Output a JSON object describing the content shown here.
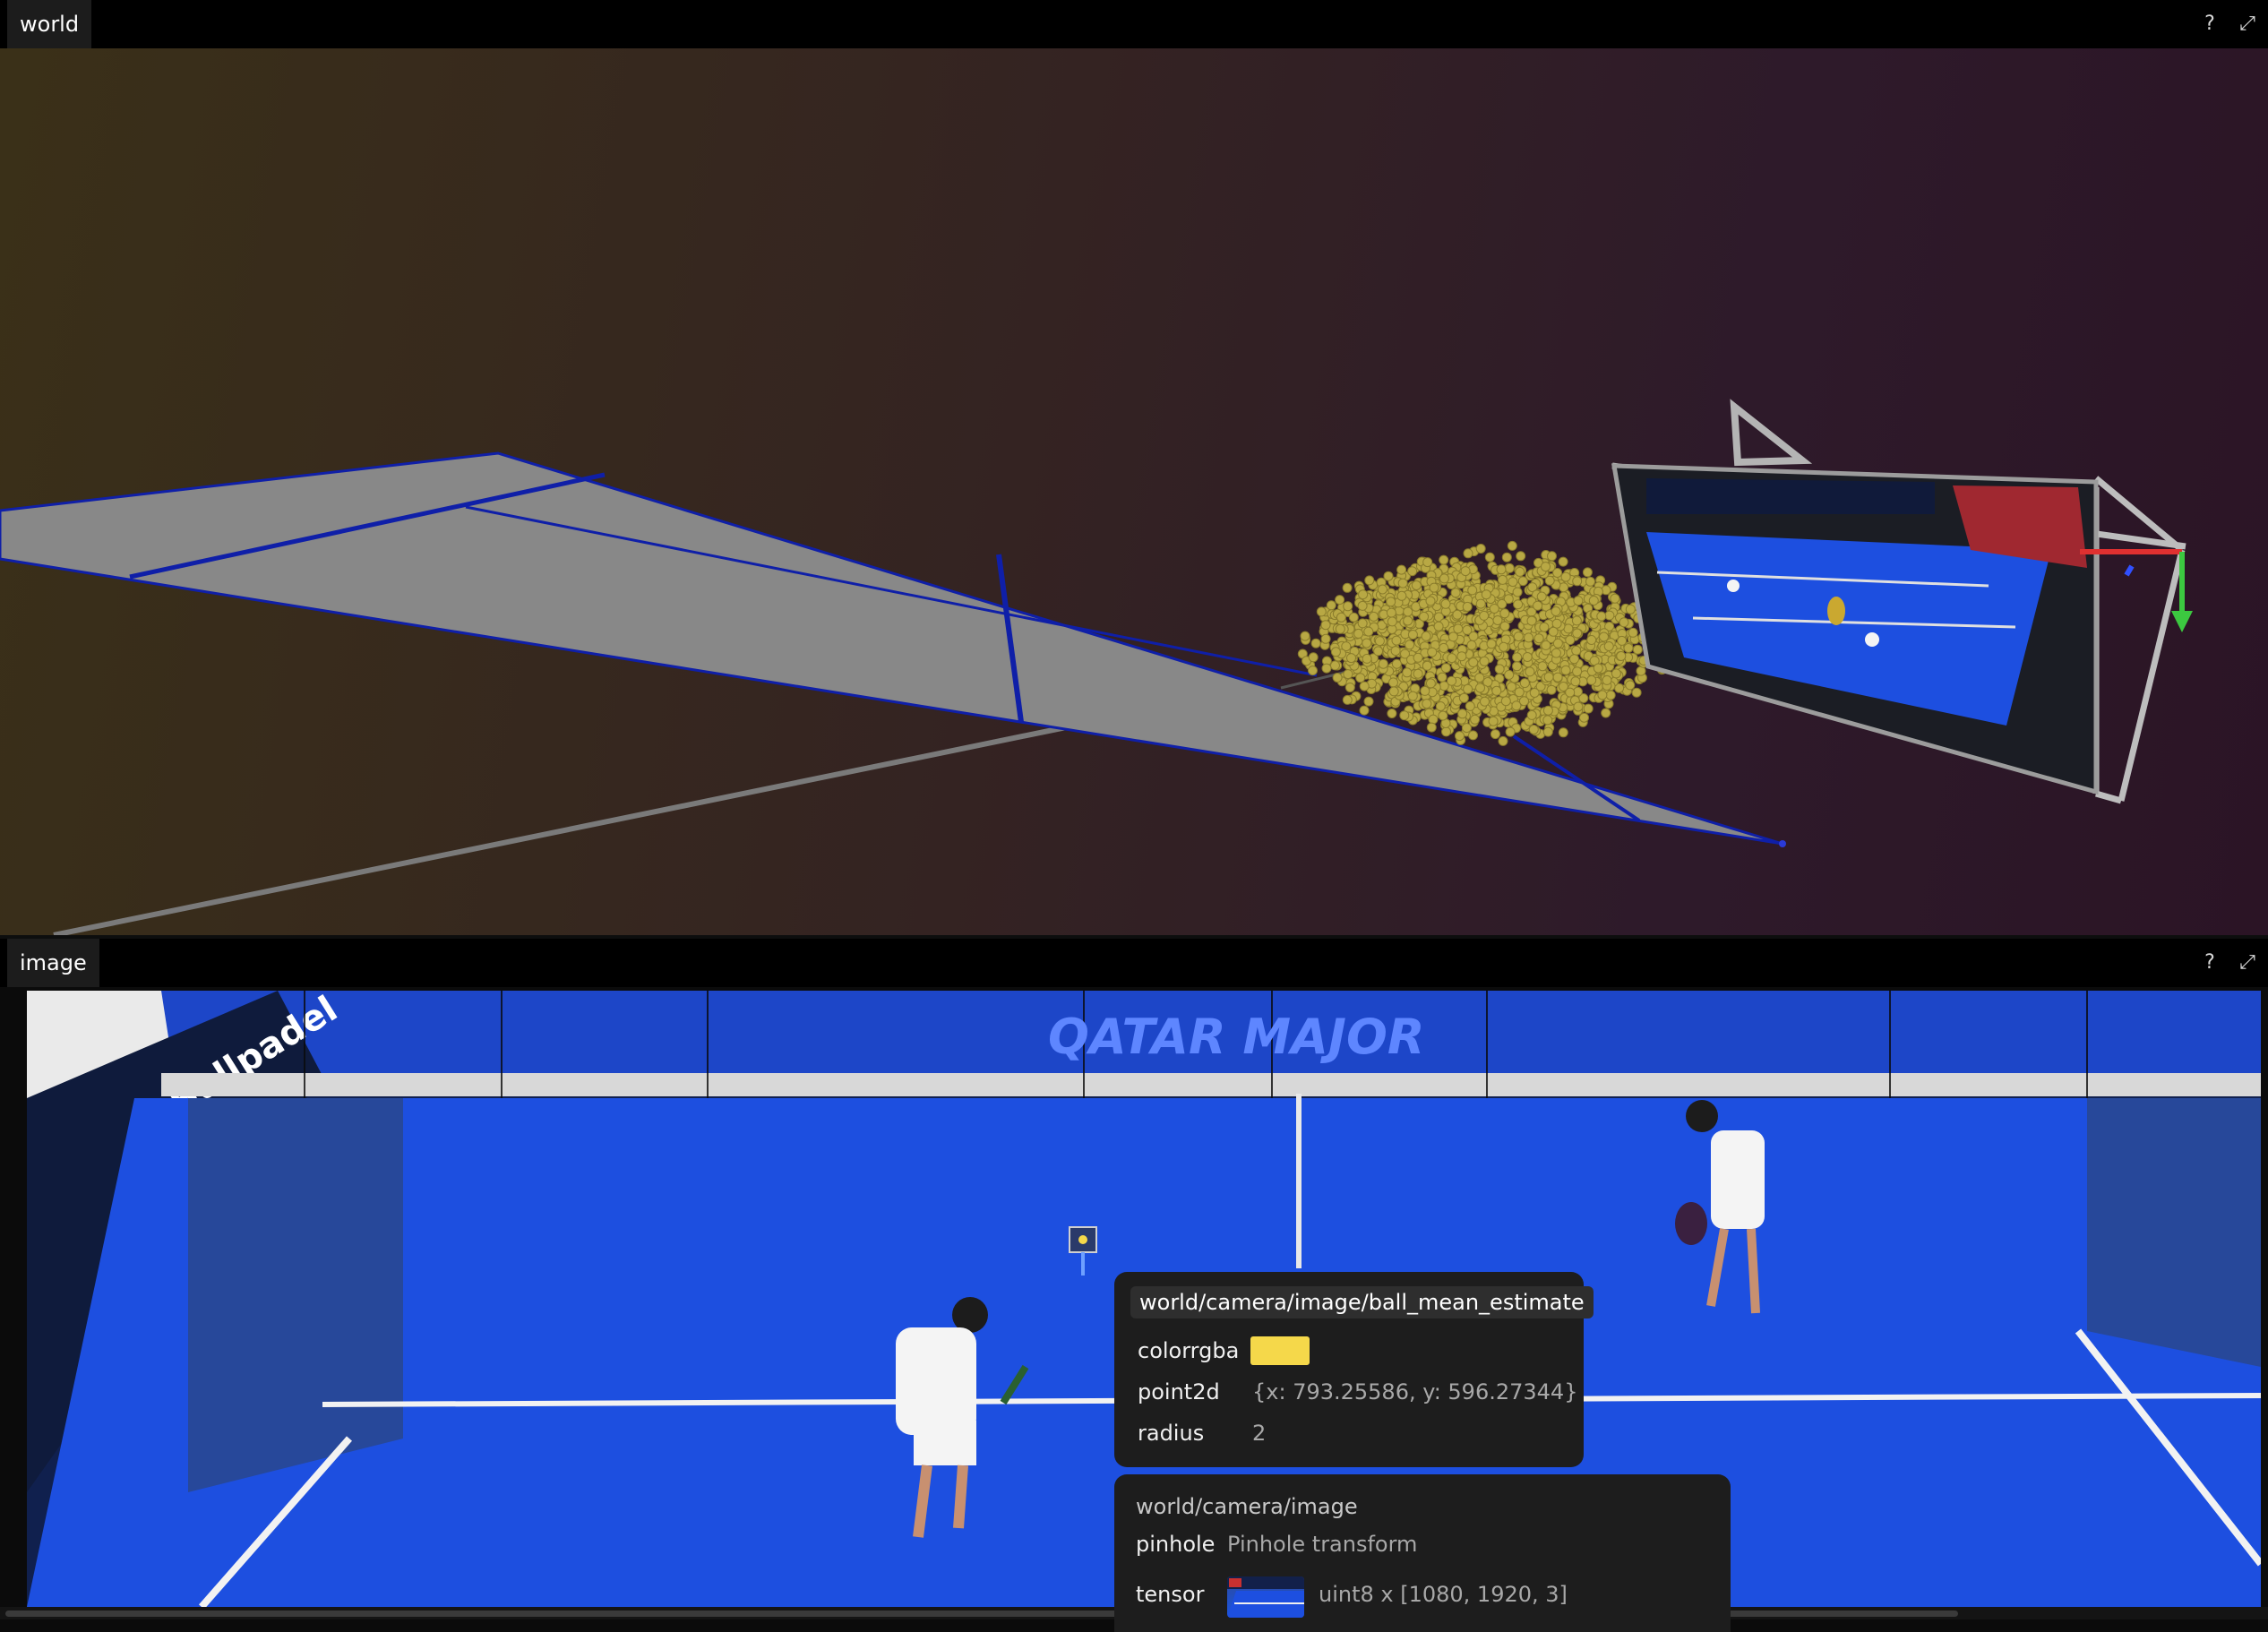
{
  "panels": {
    "world": {
      "tab_label": "world",
      "help_label": "?",
      "maximize_label": "⤢"
    },
    "image": {
      "tab_label": "image",
      "help_label": "?",
      "maximize_label": "⤢"
    }
  },
  "court_banner": "QATAR MAJOR",
  "side_banner": "Bullpadel",
  "tooltip_ball": {
    "entity_path": "world/camera/image/ball_mean_estimate",
    "rows": [
      {
        "key": "colorrgba",
        "color": "#f5d84a"
      },
      {
        "key": "point2d",
        "value": "{x: 793.25586, y: 596.27344}"
      },
      {
        "key": "radius",
        "value": "2"
      }
    ]
  },
  "tooltip_image": {
    "entity_path": "world/camera/image",
    "rows": [
      {
        "key": "pinhole",
        "value": "Pinhole transform"
      },
      {
        "key": "tensor",
        "value": "uint8 x [1080, 1920, 3]"
      }
    ]
  },
  "colors": {
    "court_surface": "#1d4fe0",
    "court_lines": "#1428c8",
    "ball_points": "#b8a844",
    "camera_frustum": "#b0b0b0",
    "axis_red": "#e03030",
    "axis_green": "#3cc840",
    "axis_blue": "#3050ff"
  }
}
